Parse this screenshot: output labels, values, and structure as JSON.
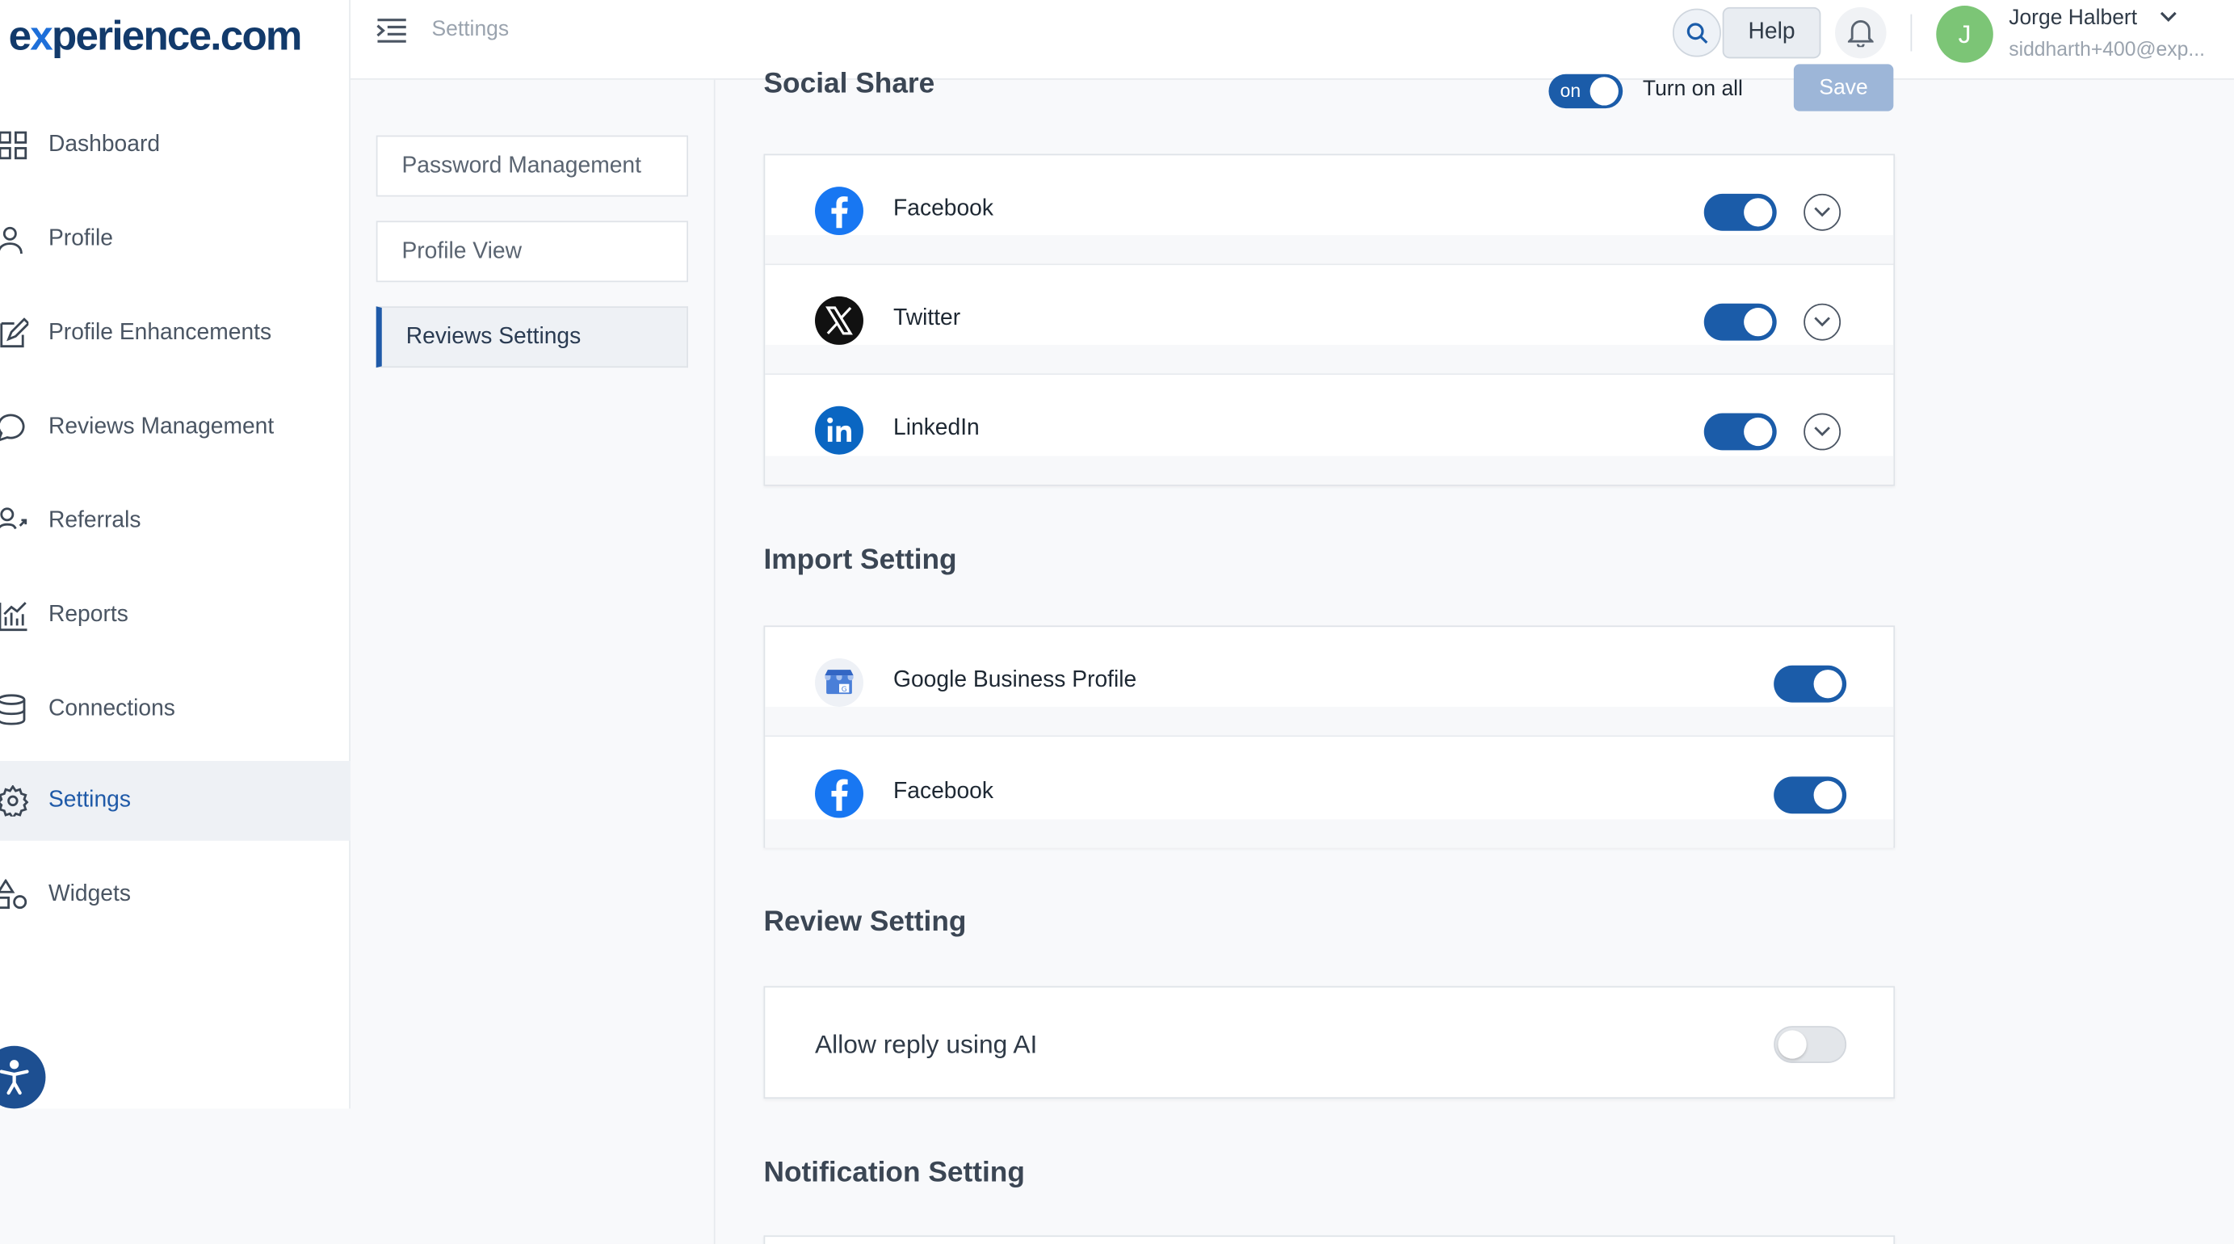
{
  "brand": {
    "logo_prefix": "e",
    "logo_x": "x",
    "logo_rest": "perience.com"
  },
  "sidebar": {
    "items": [
      {
        "label": "Dashboard",
        "icon": "grid-icon"
      },
      {
        "label": "Profile",
        "icon": "user-icon"
      },
      {
        "label": "Profile Enhancements",
        "icon": "edit-icon"
      },
      {
        "label": "Reviews Management",
        "icon": "chat-bubble-icon"
      },
      {
        "label": "Referrals",
        "icon": "referral-icon"
      },
      {
        "label": "Reports",
        "icon": "chart-icon"
      },
      {
        "label": "Connections",
        "icon": "database-icon"
      },
      {
        "label": "Settings",
        "icon": "gear-icon",
        "active": true
      },
      {
        "label": "Widgets",
        "icon": "shapes-icon"
      }
    ]
  },
  "header": {
    "breadcrumb": "Settings",
    "help_label": "Help",
    "user": {
      "initial": "J",
      "name": "Jorge Halbert",
      "email": "siddharth+400@exp..."
    }
  },
  "subnav": {
    "items": [
      {
        "label": "Password Management"
      },
      {
        "label": "Profile View"
      },
      {
        "label": "Reviews Settings",
        "active": true
      }
    ]
  },
  "social_share": {
    "title": "Social Share",
    "master_toggle_label": "on",
    "turn_on_all_label": "Turn on all",
    "save_label": "Save",
    "items": [
      {
        "name": "Facebook",
        "enabled": true,
        "icon": "facebook-icon"
      },
      {
        "name": "Twitter",
        "enabled": true,
        "icon": "x-twitter-icon"
      },
      {
        "name": "LinkedIn",
        "enabled": true,
        "icon": "linkedin-icon"
      }
    ]
  },
  "import_setting": {
    "title": "Import Setting",
    "items": [
      {
        "name": "Google Business Profile",
        "enabled": true,
        "icon": "google-business-icon"
      },
      {
        "name": "Facebook",
        "enabled": true,
        "icon": "facebook-icon"
      }
    ]
  },
  "review_setting": {
    "title": "Review Setting",
    "items": [
      {
        "name": "Allow reply using AI",
        "enabled": false
      }
    ]
  },
  "notification_setting": {
    "title": "Notification Setting"
  },
  "colors": {
    "primary": "#1b5ca9",
    "facebook": "#1877f2",
    "linkedin": "#0a66c2",
    "avatar": "#7cc576"
  }
}
